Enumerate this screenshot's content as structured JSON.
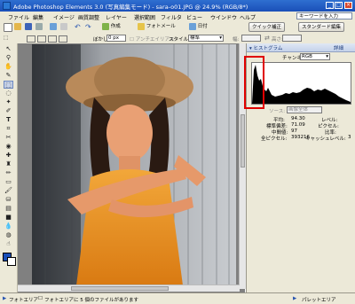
{
  "window": {
    "title": "Adobe Photoshop Elements 3.0 (写真編集モード) - sara-o01.JPG @ 24.9% (RGB/8*)",
    "min": "_",
    "max": "□",
    "close": "×"
  },
  "menu": {
    "items": [
      "ファイル",
      "編集",
      "イメージ",
      "画質調整",
      "レイヤー",
      "選択範囲",
      "フィルタ",
      "ビュー",
      "ウインドウ",
      "ヘルプ"
    ],
    "help_placeholder": "キーワードを入力"
  },
  "toolbar": {
    "create_label": "作成",
    "photomail_label": "フォトメール",
    "date_label": "日付",
    "quickfix_label": "クイック補正",
    "standard_label": "スタンダード編集"
  },
  "options": {
    "feather_label": "ぼかし:",
    "feather_value": "0 px",
    "antialias_label": "アンチエイリアス",
    "style_label": "スタイル:",
    "style_value": "標準",
    "width_label": "幅:",
    "height_label": "高さ:"
  },
  "histogram": {
    "tab_label": "ヒストグラム",
    "more_label": "詳細",
    "channel_label": "チャンネル:",
    "channel_value": "RGB",
    "source_label": "ソース:",
    "source_value": "画像全体",
    "stats": {
      "mean_label": "平均:",
      "mean": "94.30",
      "stddev_label": "標準偏差:",
      "stddev": "71.09",
      "median_label": "中間値:",
      "median": "97",
      "pixels_label": "全ピクセル:",
      "pixels": "393216",
      "level_label": "レベル:",
      "count_label": "ピクセル:",
      "percentile_label": "比率:",
      "cache_label": "キャッシュレベル:",
      "cache": "3"
    }
  },
  "status": {
    "photo_area_label": "フォトエリア",
    "message": "フォトエリアに 5 個のファイルがあります",
    "palette_label": "パレットエリア"
  }
}
